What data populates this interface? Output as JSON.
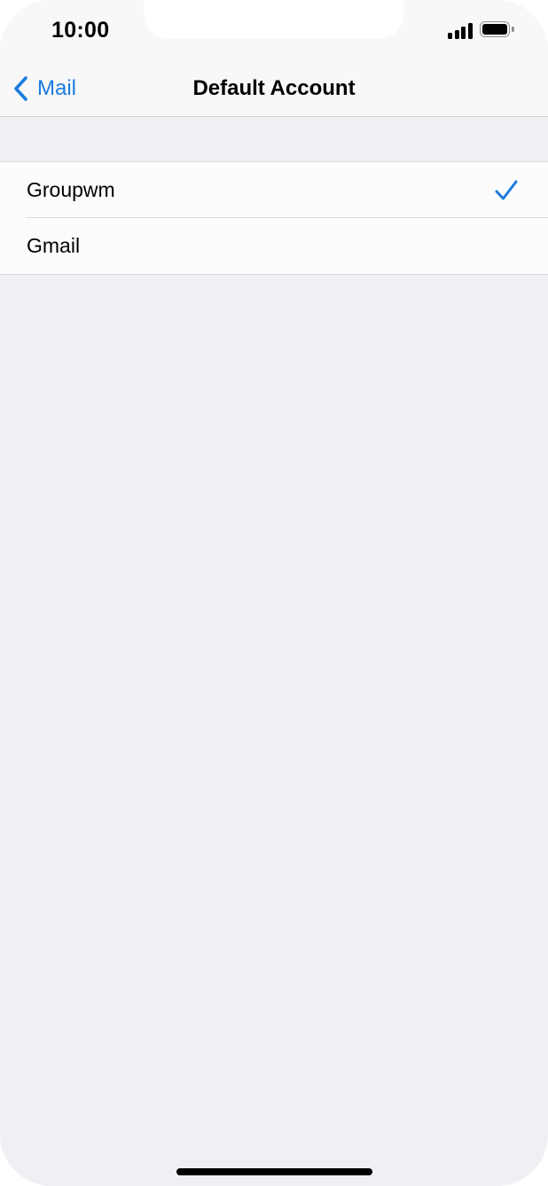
{
  "status_bar": {
    "time": "10:00"
  },
  "nav": {
    "back_label": "Mail",
    "title": "Default Account"
  },
  "accounts": [
    {
      "label": "Groupwm",
      "selected": true
    },
    {
      "label": "Gmail",
      "selected": false
    }
  ],
  "colors": {
    "accent": "#1a7ce0",
    "background": "#efeff4",
    "cell": "#fcfcfc"
  },
  "icons": {
    "back": "chevron-left-icon",
    "check": "checkmark-icon",
    "signal": "cellular-signal-icon",
    "battery": "battery-icon"
  }
}
